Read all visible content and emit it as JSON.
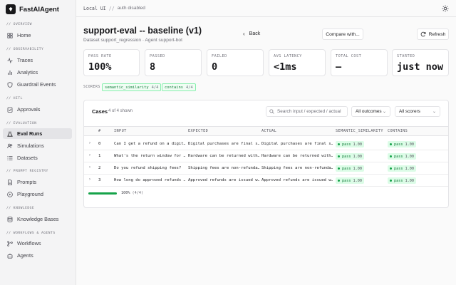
{
  "app": {
    "name": "FastAIAgent"
  },
  "topbar": {
    "env": "Local UI",
    "separator": "//",
    "auth": "auth disabled"
  },
  "sidebar": {
    "sections": [
      {
        "label": "// OVERVIEW",
        "items": [
          {
            "label": "Home",
            "icon": "home-icon",
            "active": false
          }
        ]
      },
      {
        "label": "// OBSERVABILITY",
        "items": [
          {
            "label": "Traces",
            "icon": "activity-icon",
            "active": false
          },
          {
            "label": "Analytics",
            "icon": "bar-chart-icon",
            "active": false
          },
          {
            "label": "Guardrail Events",
            "icon": "shield-icon",
            "active": false
          }
        ]
      },
      {
        "label": "// HITL",
        "items": [
          {
            "label": "Approvals",
            "icon": "clipboard-check-icon",
            "active": false
          }
        ]
      },
      {
        "label": "// EVALUATION",
        "items": [
          {
            "label": "Eval Runs",
            "icon": "flask-icon",
            "active": true
          },
          {
            "label": "Simulations",
            "icon": "users-icon",
            "active": false
          },
          {
            "label": "Datasets",
            "icon": "list-icon",
            "active": false
          }
        ]
      },
      {
        "label": "// PROMPT REGISTRY",
        "items": [
          {
            "label": "Prompts",
            "icon": "file-text-icon",
            "active": false
          },
          {
            "label": "Playground",
            "icon": "play-icon",
            "active": false
          }
        ]
      },
      {
        "label": "// KNOWLEDGE",
        "items": [
          {
            "label": "Knowledge Bases",
            "icon": "database-icon",
            "active": false
          }
        ]
      },
      {
        "label": "// WORKFLOWS & AGENTS",
        "items": [
          {
            "label": "Workflows",
            "icon": "workflow-icon",
            "active": false
          },
          {
            "label": "Agents",
            "icon": "bot-icon",
            "active": false
          }
        ]
      }
    ]
  },
  "header": {
    "title": "support-eval -- baseline (v1)",
    "subtitle": "Dataset support_regression · Agent support-bot",
    "back_label": "Back",
    "compare_label": "Compare with...",
    "refresh_label": "Refresh"
  },
  "stats": [
    {
      "label": "PASS RATE",
      "value": "100%"
    },
    {
      "label": "PASSED",
      "value": "8"
    },
    {
      "label": "FAILED",
      "value": "0"
    },
    {
      "label": "AVG LATENCY",
      "value": "<1ms"
    },
    {
      "label": "TOTAL COST",
      "value": "—"
    },
    {
      "label": "STARTED",
      "value": "just now"
    }
  ],
  "scorers": {
    "label": "SCORERS",
    "items": [
      {
        "name": "semantic_similarity",
        "count": "4/4"
      },
      {
        "name": "contains",
        "count": "4/4"
      }
    ]
  },
  "cases": {
    "title": "Cases",
    "count_text": "4 of 4 shown",
    "search_placeholder": "Search input / expected / actual",
    "outcome_filter": "All outcomes",
    "scorer_filter": "All scorers",
    "columns": [
      "#",
      "INPUT",
      "EXPECTED",
      "ACTUAL",
      "SEMANTIC_SIMILARITY",
      "CONTAINS"
    ],
    "rows": [
      {
        "num": "0",
        "input": "Can I get a refund on a digit…",
        "expected": "Digital purchases are final s…",
        "actual": "Digital purchases are final s…",
        "semantic_similarity": {
          "status": "pass",
          "score": "1.00"
        },
        "contains": {
          "status": "pass",
          "score": "1.00"
        }
      },
      {
        "num": "1",
        "input": "What's the return window for …",
        "expected": "Hardware can be returned with…",
        "actual": "Hardware can be returned with…",
        "semantic_similarity": {
          "status": "pass",
          "score": "1.00"
        },
        "contains": {
          "status": "pass",
          "score": "1.00"
        }
      },
      {
        "num": "2",
        "input": "Do you refund shipping fees?",
        "expected": "Shipping fees are non-refunda…",
        "actual": "Shipping fees are non-refunda…",
        "semantic_similarity": {
          "status": "pass",
          "score": "1.00"
        },
        "contains": {
          "status": "pass",
          "score": "1.00"
        }
      },
      {
        "num": "3",
        "input": "How long do approved refunds …",
        "expected": "Approved refunds are issued w…",
        "actual": "Approved refunds are issued w…",
        "semantic_similarity": {
          "status": "pass",
          "score": "1.00"
        },
        "contains": {
          "status": "pass",
          "score": "1.00"
        }
      }
    ],
    "progress": {
      "percent": 100,
      "label": "100%",
      "detail": "(4/4)"
    }
  }
}
